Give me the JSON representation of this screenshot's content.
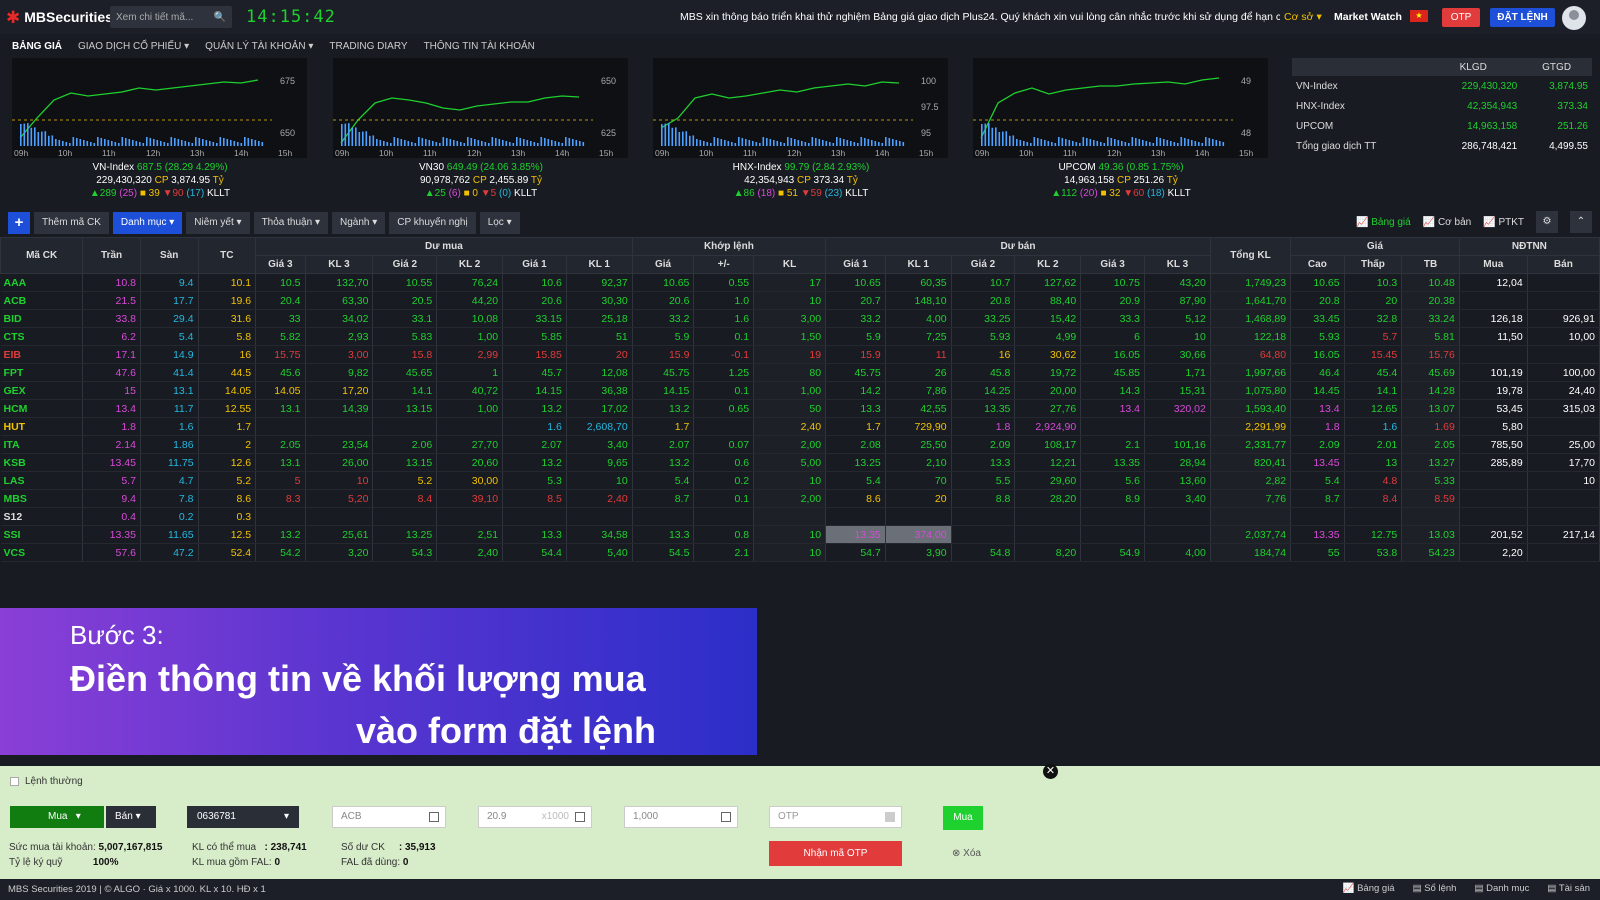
{
  "header": {
    "logo": "MBSecurities",
    "search_placeholder": "Xem chi tiết mã...",
    "clock": "14:15:42",
    "marquee": "MBS xin thông báo triển khai thử nghiệm Bảng giá giao dịch Plus24. Quý khách xin vui lòng cân nhắc trước khi sử dụng để hạn chế sai",
    "co_so": "Cơ sở",
    "market_watch": "Market Watch",
    "otp": "OTP",
    "dat_lenh": "ĐẶT LỆNH"
  },
  "nav": [
    "BẢNG GIÁ",
    "GIAO DỊCH CỔ PHIẾU",
    "QUẢN LÝ TÀI KHOẢN",
    "TRADING DIARY",
    "THÔNG TIN TÀI KHOẢN"
  ],
  "indices": [
    {
      "name": "VN-Index",
      "value": "687.5",
      "change": "(28.29 4.29%)",
      "vol": "229,430,320",
      "cp": "CP",
      "gt": "3,874.95",
      "ty": "Tỷ",
      "adv": "289",
      "ceil": "(25)",
      "ref": "39",
      "dec": "90",
      "floor": "(17)",
      "kllt": "KLLT",
      "ticks": [
        "675",
        "650"
      ],
      "times": [
        "09h",
        "10h",
        "11h",
        "12h",
        "13h",
        "14h",
        "15h"
      ]
    },
    {
      "name": "VN30",
      "value": "649.49",
      "change": "(24.06 3.85%)",
      "vol": "90,978,762",
      "cp": "CP",
      "gt": "2,455.89",
      "ty": "Tỷ",
      "adv": "25",
      "ceil": "(6)",
      "ref": "0",
      "dec": "5",
      "floor": "(0)",
      "kllt": "KLLT",
      "ticks": [
        "650",
        "625"
      ],
      "times": [
        "09h",
        "10h",
        "11h",
        "12h",
        "13h",
        "14h",
        "15h"
      ]
    },
    {
      "name": "HNX-Index",
      "value": "99.79",
      "change": "(2.84 2.93%)",
      "vol": "42,354,943",
      "cp": "CP",
      "gt": "373.34",
      "ty": "Tỷ",
      "adv": "86",
      "ceil": "(18)",
      "ref": "51",
      "dec": "59",
      "floor": "(23)",
      "kllt": "KLLT",
      "ticks": [
        "100",
        "97.5",
        "95"
      ],
      "times": [
        "09h",
        "10h",
        "11h",
        "12h",
        "13h",
        "14h",
        "15h"
      ]
    },
    {
      "name": "UPCOM",
      "value": "49.36",
      "change": "(0.85 1.75%)",
      "vol": "14,963,158",
      "cp": "CP",
      "gt": "251.26",
      "ty": "Tỷ",
      "adv": "112",
      "ceil": "(20)",
      "ref": "32",
      "dec": "60",
      "floor": "(18)",
      "kllt": "KLLT",
      "ticks": [
        "49",
        "48"
      ],
      "times": [
        "09h",
        "10h",
        "11h",
        "12h",
        "13h",
        "14h",
        "15h"
      ]
    }
  ],
  "summary": {
    "headers": [
      "KLGD",
      "GTGD"
    ],
    "rows": [
      [
        "VN-Index",
        "229,430,320",
        "3,874.95"
      ],
      [
        "HNX-Index",
        "42,354,943",
        "373.34"
      ],
      [
        "UPCOM",
        "14,963,158",
        "251.26"
      ],
      [
        "Tổng giao dịch TT",
        "286,748,421",
        "4,499.55"
      ]
    ]
  },
  "toolbar": {
    "add": "Thêm mã CK",
    "buttons": [
      "Danh mục",
      "Niêm yết",
      "Thỏa thuận",
      "Ngành",
      "CP khuyến nghị",
      "Lọc"
    ],
    "right": [
      "Bảng giá",
      "Cơ bản",
      "PTKT"
    ]
  },
  "board": {
    "groups": [
      "Dư mua",
      "Khớp lệnh",
      "Dư bán",
      "Giá",
      "NĐTNN"
    ],
    "headers": [
      "Mã CK",
      "Trần",
      "Sàn",
      "TC",
      "Giá 3",
      "KL 3",
      "Giá 2",
      "KL 2",
      "Giá 1",
      "KL 1",
      "Giá",
      "+/-",
      "KL",
      "Giá 1",
      "KL 1",
      "Giá 2",
      "KL 2",
      "Giá 3",
      "KL 3",
      "Tổng KL",
      "Cao",
      "Thấp",
      "TB",
      "Mua",
      "Bán"
    ],
    "rows": [
      [
        "AAA",
        "10.8",
        "9.4",
        "10.1",
        "10.5",
        "132,70",
        "10.55",
        "76,24",
        "10.6",
        "92,37",
        "10.65",
        "0.55",
        "17",
        "10.65",
        "60,35",
        "10.7",
        "127,62",
        "10.75",
        "43,20",
        "1,749,23",
        "10.65",
        "10.3",
        "10.48",
        "12,04",
        ""
      ],
      [
        "ACB",
        "21.5",
        "17.7",
        "19.6",
        "20.4",
        "63,30",
        "20.5",
        "44,20",
        "20.6",
        "30,30",
        "20.6",
        "1.0",
        "10",
        "20.7",
        "148,10",
        "20.8",
        "88,40",
        "20.9",
        "87,90",
        "1,641,70",
        "20.8",
        "20",
        "20.38",
        "",
        ""
      ],
      [
        "BID",
        "33.8",
        "29.4",
        "31.6",
        "33",
        "34,02",
        "33.1",
        "10,08",
        "33.15",
        "25,18",
        "33.2",
        "1.6",
        "3,00",
        "33.2",
        "4,00",
        "33.25",
        "15,42",
        "33.3",
        "5,12",
        "1,468,89",
        "33.45",
        "32.8",
        "33.24",
        "126,18",
        "926,91"
      ],
      [
        "CTS",
        "6.2",
        "5.4",
        "5.8",
        "5.82",
        "2,93",
        "5.83",
        "1,00",
        "5.85",
        "51",
        "5.9",
        "0.1",
        "1,50",
        "5.9",
        "7,25",
        "5.93",
        "4,99",
        "6",
        "10",
        "122,18",
        "5.93",
        "5.7",
        "5.81",
        "11,50",
        "10,00"
      ],
      [
        "EIB",
        "17.1",
        "14.9",
        "16",
        "15.75",
        "3,00",
        "15.8",
        "2,99",
        "15.85",
        "20",
        "15.9",
        "-0.1",
        "19",
        "15.9",
        "11",
        "16",
        "30,62",
        "16.05",
        "30,66",
        "64,80",
        "16.05",
        "15.45",
        "15.76",
        "",
        ""
      ],
      [
        "FPT",
        "47.6",
        "41.4",
        "44.5",
        "45.6",
        "9,82",
        "45.65",
        "1",
        "45.7",
        "12,08",
        "45.75",
        "1.25",
        "80",
        "45.75",
        "26",
        "45.8",
        "19,72",
        "45.85",
        "1,71",
        "1,997,66",
        "46.4",
        "45.4",
        "45.69",
        "101,19",
        "100,00"
      ],
      [
        "GEX",
        "15",
        "13.1",
        "14.05",
        "14.05",
        "17,20",
        "14.1",
        "40,72",
        "14.15",
        "36,38",
        "14.15",
        "0.1",
        "1,00",
        "14.2",
        "7,86",
        "14.25",
        "20,00",
        "14.3",
        "15,31",
        "1,075,80",
        "14.45",
        "14.1",
        "14.28",
        "19,78",
        "24,40"
      ],
      [
        "HCM",
        "13.4",
        "11.7",
        "12.55",
        "13.1",
        "14,39",
        "13.15",
        "1,00",
        "13.2",
        "17,02",
        "13.2",
        "0.65",
        "50",
        "13.3",
        "42,55",
        "13.35",
        "27,76",
        "13.4",
        "320,02",
        "1,593,40",
        "13.4",
        "12.65",
        "13.07",
        "53,45",
        "315,03"
      ],
      [
        "HUT",
        "1.8",
        "1.6",
        "1.7",
        "",
        "",
        "",
        "",
        "1.6",
        "2,608,70",
        "1.7",
        "",
        "2,40",
        "1.7",
        "729,90",
        "1.8",
        "2,924,90",
        "",
        "",
        "2,291,99",
        "1.8",
        "1.6",
        "1.69",
        "5,80",
        ""
      ],
      [
        "ITA",
        "2.14",
        "1.86",
        "2",
        "2.05",
        "23,54",
        "2.06",
        "27,70",
        "2.07",
        "3,40",
        "2.07",
        "0.07",
        "2,00",
        "2.08",
        "25,50",
        "2.09",
        "108,17",
        "2.1",
        "101,16",
        "2,331,77",
        "2.09",
        "2.01",
        "2.05",
        "785,50",
        "25,00"
      ],
      [
        "KSB",
        "13.45",
        "11.75",
        "12.6",
        "13.1",
        "26,00",
        "13.15",
        "20,60",
        "13.2",
        "9,65",
        "13.2",
        "0.6",
        "5,00",
        "13.25",
        "2,10",
        "13.3",
        "12,21",
        "13.35",
        "28,94",
        "820,41",
        "13.45",
        "13",
        "13.27",
        "285,89",
        "17,70"
      ],
      [
        "LAS",
        "5.7",
        "4.7",
        "5.2",
        "5",
        "10",
        "5.2",
        "30,00",
        "5.3",
        "10",
        "5.4",
        "0.2",
        "10",
        "5.4",
        "70",
        "5.5",
        "29,60",
        "5.6",
        "13,60",
        "2,82",
        "5.4",
        "4.8",
        "5.33",
        "",
        "10"
      ],
      [
        "MBS",
        "9.4",
        "7.8",
        "8.6",
        "8.3",
        "5,20",
        "8.4",
        "39,10",
        "8.5",
        "2,40",
        "8.7",
        "0.1",
        "2,00",
        "8.6",
        "20",
        "8.8",
        "28,20",
        "8.9",
        "3,40",
        "7,76",
        "8.7",
        "8.4",
        "8.59",
        "",
        ""
      ],
      [
        "S12",
        "0.4",
        "0.2",
        "0.3",
        "",
        "",
        "",
        "",
        "",
        "",
        "",
        "",
        "",
        "",
        "",
        "",
        "",
        "",
        "",
        "",
        "",
        "",
        "",
        "",
        ""
      ],
      [
        "SSI",
        "13.35",
        "11.65",
        "12.5",
        "13.2",
        "25,61",
        "13.25",
        "2,51",
        "13.3",
        "34,58",
        "13.3",
        "0.8",
        "10",
        "13.35",
        "374,00",
        "",
        "",
        "",
        "",
        "2,037,74",
        "13.35",
        "12.75",
        "13.03",
        "201,52",
        "217,14"
      ],
      [
        "VCS",
        "57.6",
        "47.2",
        "52.4",
        "54.2",
        "3,20",
        "54.3",
        "2,40",
        "54.4",
        "5,40",
        "54.5",
        "2.1",
        "10",
        "54.7",
        "3,90",
        "54.8",
        "8,20",
        "54.9",
        "4,00",
        "184,74",
        "55",
        "53.8",
        "54.23",
        "2,20",
        ""
      ]
    ]
  },
  "banner": {
    "step": "Bước 3:",
    "line1": "Điền thông tin về khối lượng mua",
    "line2": "vào form đặt lệnh"
  },
  "order": {
    "type_label": "Lệnh thường",
    "buy": "Mua",
    "sell": "Bán",
    "account": "0636781",
    "symbol": "ACB",
    "price": "20.9",
    "price_unit": "x1000",
    "qty": "1,000",
    "otp_placeholder": "OTP",
    "get_otp": "Nhận mã OTP",
    "submit": "Mua",
    "clear": "Xóa",
    "info1": [
      [
        "Sức mua tài khoản:",
        "5,007,167,815"
      ],
      [
        "Tỷ lệ ký quỹ",
        "100%"
      ]
    ],
    "info2": [
      [
        "KL có thể mua",
        ": 238,741"
      ],
      [
        "KL mua gồm FAL:",
        "0"
      ]
    ],
    "info3": [
      [
        "Số dư CK",
        ": 35,913"
      ],
      [
        "FAL đã dùng:",
        "0"
      ]
    ]
  },
  "status": {
    "left": "MBS Securities 2019 | © ALGO · Giá x 1000. KL x 10. HĐ x 1",
    "right": [
      "Bảng giá",
      "Sổ lệnh",
      "Danh mục",
      "Tài sản"
    ]
  }
}
